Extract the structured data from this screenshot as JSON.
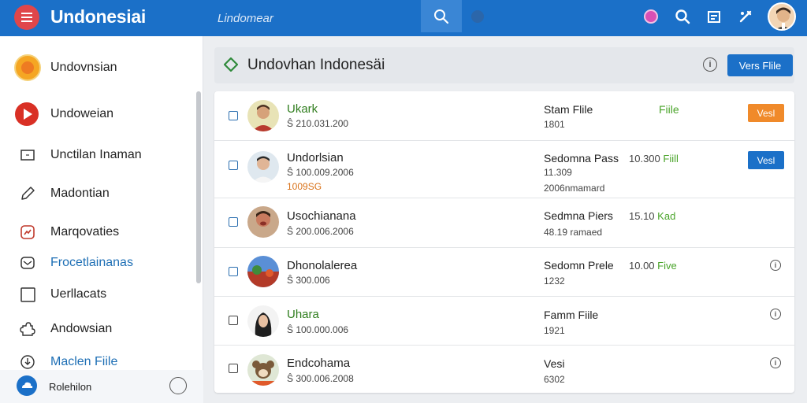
{
  "app": {
    "title": "Undonesiai"
  },
  "search": {
    "placeholder": "Lindomear"
  },
  "colors": {
    "brand": "#1b70c8",
    "menu": "#e0464a",
    "accent_orange": "#f08a2a",
    "success_green": "#4aa42a"
  },
  "icons": [
    "menu-icon",
    "search-icon",
    "notification-icon",
    "search-icon",
    "calendar-icon",
    "tools-icon",
    "user-avatar"
  ],
  "sidebar": {
    "items": [
      {
        "label": "Undovnsian",
        "icon": "sun-icon"
      },
      {
        "label": "Undoweian",
        "icon": "play-icon"
      },
      {
        "label": "Unctilan Inaman",
        "icon": "folder-icon"
      },
      {
        "label": "Madontian",
        "icon": "pen-icon"
      },
      {
        "label": "Marqovaties",
        "icon": "chart-icon"
      },
      {
        "label": "Frocetlainanas",
        "icon": "mail-icon"
      },
      {
        "label": "Uerllacats",
        "icon": "square-icon"
      },
      {
        "label": "Andowsian",
        "icon": "puzzle-icon"
      },
      {
        "label": "Maclen Fiile",
        "icon": "download-icon"
      }
    ],
    "footer": {
      "label": "Rolehilon",
      "icon": "cloud-icon"
    }
  },
  "header": {
    "title": "Undovhan Indonesäi",
    "button": "Vers Flile"
  },
  "rows": [
    {
      "name": "Ukark",
      "sub": "Ŝ 210.031.200",
      "type": "Stam Flile",
      "size": "1801",
      "file": "Fiile",
      "button": "Vesl"
    },
    {
      "name": "Undorlsian",
      "sub": "Ŝ 100.009.2006",
      "sub2": "1009SG",
      "type": "Sedomna Pass",
      "size": "11.309",
      "size2": "2006nmamard",
      "meta": "10.300",
      "meta2": "Fiill",
      "button": "Vesl"
    },
    {
      "name": "Usochianana",
      "sub": "Ŝ 200.006.2006",
      "type": "Sedmna Piers",
      "size": "48.19 ramaed",
      "meta": "15.10",
      "meta2": "Kad"
    },
    {
      "name": "Dhonolalerea",
      "sub": "Ŝ 300.006",
      "type": "Sedomn Prele",
      "size": "1232",
      "meta": "10.00",
      "meta2": "Five"
    },
    {
      "name": "Uhara",
      "sub": "Ŝ 100.000.006",
      "type": "Famm Fiile",
      "size": "1921"
    },
    {
      "name": "Endcohama",
      "sub": "Ŝ 300.006.2008",
      "type": "Vesi",
      "size": "6302"
    }
  ]
}
